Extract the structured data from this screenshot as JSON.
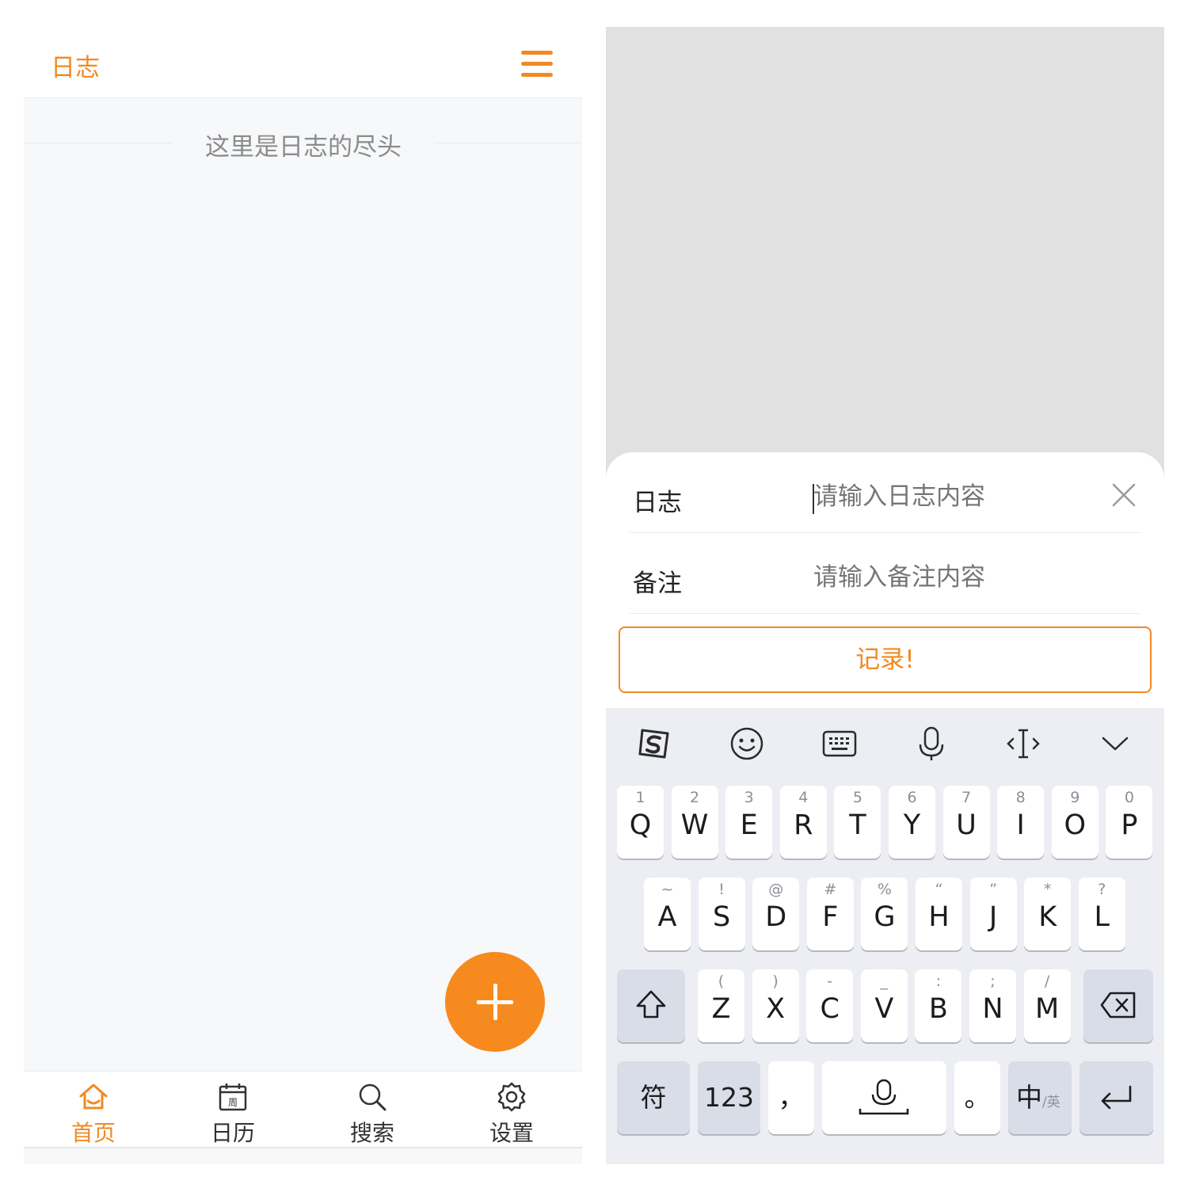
{
  "accent_color": "#f08a24",
  "left": {
    "header": {
      "title": "日志",
      "menu_icon": "menu-icon"
    },
    "end_text": "这里是日志的尽头",
    "fab_icon": "plus-icon",
    "tabs": [
      {
        "label": "首页",
        "icon": "home-icon",
        "active": true
      },
      {
        "label": "日历",
        "icon": "calendar-icon",
        "icon_text": "周",
        "active": false
      },
      {
        "label": "搜索",
        "icon": "search-icon",
        "active": false
      },
      {
        "label": "设置",
        "icon": "gear-icon",
        "active": false
      }
    ]
  },
  "right": {
    "form": {
      "log_label": "日志",
      "log_placeholder": "请输入日志内容",
      "note_label": "备注",
      "note_placeholder": "请输入备注内容",
      "submit_label": "记录!"
    },
    "keyboard": {
      "toolbar_icons": [
        "sogou-icon",
        "emoji-icon",
        "keyboard-icon",
        "microphone-icon",
        "cursor-icon",
        "chevron-down-icon"
      ],
      "row1": [
        {
          "main": "Q",
          "sub": "1"
        },
        {
          "main": "W",
          "sub": "2"
        },
        {
          "main": "E",
          "sub": "3"
        },
        {
          "main": "R",
          "sub": "4"
        },
        {
          "main": "T",
          "sub": "5"
        },
        {
          "main": "Y",
          "sub": "6"
        },
        {
          "main": "U",
          "sub": "7"
        },
        {
          "main": "I",
          "sub": "8"
        },
        {
          "main": "O",
          "sub": "9"
        },
        {
          "main": "P",
          "sub": "0"
        }
      ],
      "row2": [
        {
          "main": "A",
          "sub": "~"
        },
        {
          "main": "S",
          "sub": "!"
        },
        {
          "main": "D",
          "sub": "@"
        },
        {
          "main": "F",
          "sub": "#"
        },
        {
          "main": "G",
          "sub": "%"
        },
        {
          "main": "H",
          "sub": "“"
        },
        {
          "main": "J",
          "sub": "”"
        },
        {
          "main": "K",
          "sub": "*"
        },
        {
          "main": "L",
          "sub": "?"
        }
      ],
      "row3": [
        {
          "main": "Z",
          "sub": "("
        },
        {
          "main": "X",
          "sub": ")"
        },
        {
          "main": "C",
          "sub": "-"
        },
        {
          "main": "V",
          "sub": "_"
        },
        {
          "main": "B",
          "sub": ":"
        },
        {
          "main": "N",
          "sub": ";"
        },
        {
          "main": "M",
          "sub": "/"
        }
      ],
      "symbol_key": "符",
      "number_key": "123",
      "comma_key": "，",
      "period_key": "。",
      "lang_key": "中",
      "lang_sub": "/英"
    }
  }
}
